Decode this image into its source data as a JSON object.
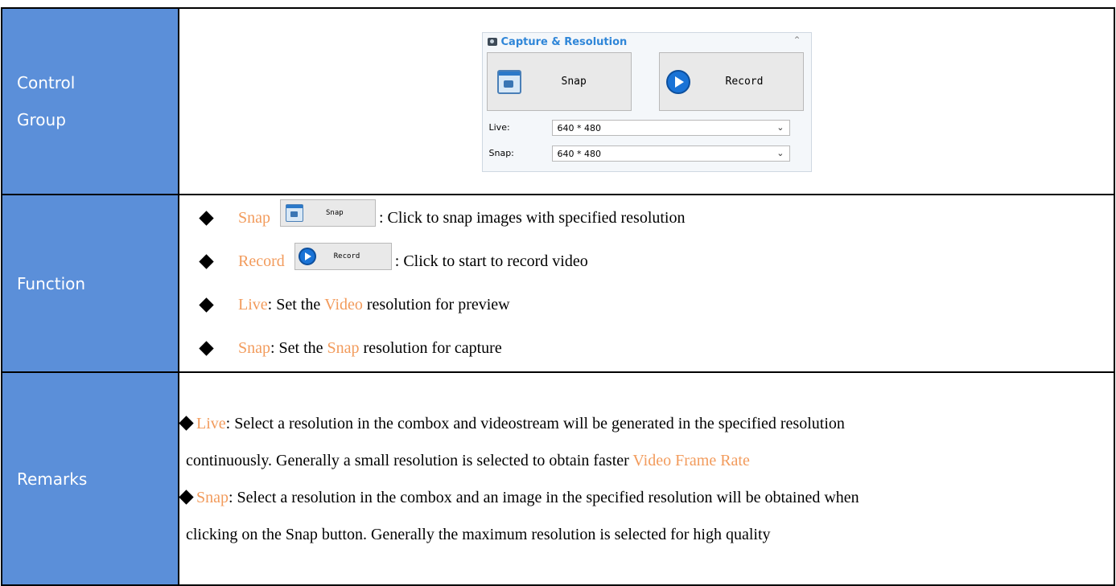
{
  "rows": {
    "control": {
      "label_line1": "Control",
      "label_line2": "Group"
    },
    "function": {
      "label": "Function"
    },
    "remarks": {
      "label": "Remarks"
    }
  },
  "panel": {
    "title": "Capture & Resolution",
    "icon": "camera-icon",
    "collapse_icon": "double-chevron-up-icon",
    "snap_button": "Snap",
    "record_button": "Record",
    "live_label": "Live:",
    "live_value": "640 * 480",
    "snap_label": "Snap:",
    "snap_value": "640 * 480",
    "title_color": "#2f86d8"
  },
  "function_items": [
    {
      "term": "Snap",
      "button_label": "Snap",
      "text": ": Click to snap images with specified resolution"
    },
    {
      "term": "Record",
      "button_label": "Record",
      "text": ": Click to start to record video"
    },
    {
      "term": "Live",
      "text_a": ": Set the ",
      "term2": "Video",
      "text_b": " resolution for preview"
    },
    {
      "term": "Snap",
      "text_a": ": Set the ",
      "term2": "Snap",
      "text_b": " resolution for capture"
    }
  ],
  "remarks": {
    "live_term": "Live",
    "live_text_1": ": Select a resolution in the combox and videostream will be generated in the specified resolution",
    "live_text_2": "continuously. Generally a small resolution is selected to obtain faster ",
    "live_term2": "Video Frame Rate",
    "snap_term": "Snap",
    "snap_text_1": ": Select a resolution in the combox and an image in the specified resolution will be obtained when",
    "snap_text_2": "clicking on the Snap button. Generally the maximum resolution is selected for high quality"
  },
  "colors": {
    "label_bg": "#5b8fd9",
    "accent": "#f29b5c"
  }
}
